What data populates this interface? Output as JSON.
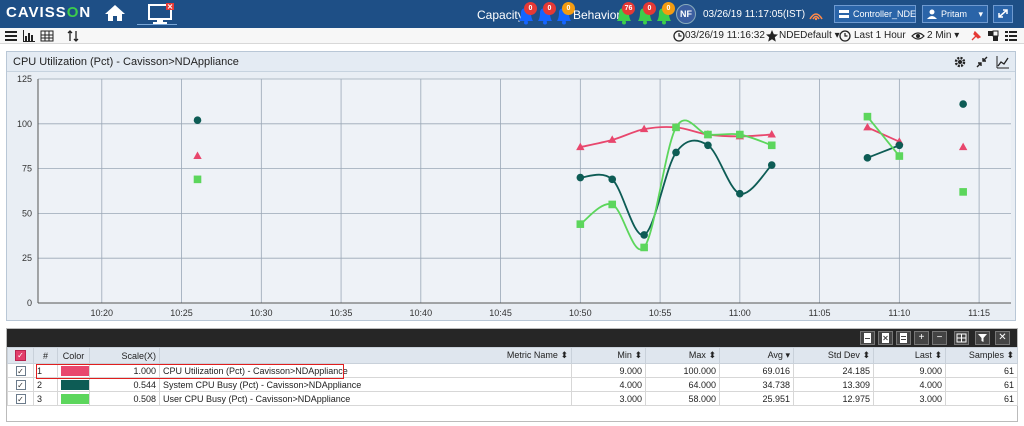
{
  "header": {
    "logo_prefix": "CAVISS",
    "logo_o": "O",
    "logo_suffix": "N",
    "capacity_label": "Capacity",
    "behavior_label": "Behavior",
    "capacity_alerts": [
      "0",
      "0",
      "0"
    ],
    "behavior_alerts": [
      "76",
      "0",
      "0"
    ],
    "avatar": "NF",
    "datetime": "03/26/19 11:17:05(IST)",
    "controller_button": "Controller_NDE",
    "user_button": "Pritam",
    "colors": {
      "bar": "#1e4f86",
      "critical": "#e53935",
      "major": "#f39c12",
      "minor": "#3ccd4b",
      "bell": "#1565ff"
    }
  },
  "toolbar": {
    "timestamp": "03/26/19 11:16:32",
    "favorite": "NDEDefault",
    "duration": "Last 1 Hour",
    "interval": "2 Min"
  },
  "panel": {
    "title": "CPU Utilization (Pct) - Cavisson>NDAppliance"
  },
  "chart_data": {
    "type": "line",
    "title": "CPU Utilization (Pct) - Cavisson>NDAppliance",
    "xlim": [
      "10:16",
      "11:17"
    ],
    "ylim": [
      0,
      125
    ],
    "y_ticks": [
      0,
      25,
      50,
      75,
      100,
      125
    ],
    "x_ticks": [
      "10:20",
      "10:25",
      "10:30",
      "10:35",
      "10:40",
      "10:45",
      "10:50",
      "10:55",
      "11:00",
      "11:05",
      "11:10",
      "11:15"
    ],
    "grid": true,
    "series": [
      {
        "name": "CPU Utilization (Pct) - Cavisson>NDAppliance",
        "color": "#e8476d",
        "marker": "triangle",
        "points": [
          [
            "10:26",
            82
          ],
          [
            "10:50",
            87
          ],
          [
            "10:52",
            91
          ],
          [
            "10:54",
            97
          ],
          [
            "10:56",
            98
          ],
          [
            "10:58",
            94
          ],
          [
            "11:00",
            93
          ],
          [
            "11:02",
            94
          ],
          [
            "11:08",
            98
          ],
          [
            "11:10",
            90
          ],
          [
            "11:14",
            87
          ]
        ],
        "segments": [
          [
            1,
            7
          ],
          [
            8,
            9
          ]
        ]
      },
      {
        "name": "System CPU Busy (Pct) - Cavisson>NDAppliance",
        "color": "#0d5c55",
        "marker": "circle",
        "points": [
          [
            "10:26",
            102
          ],
          [
            "10:50",
            70
          ],
          [
            "10:52",
            69
          ],
          [
            "10:54",
            38
          ],
          [
            "10:56",
            84
          ],
          [
            "10:58",
            88
          ],
          [
            "11:00",
            61
          ],
          [
            "11:02",
            77
          ],
          [
            "11:08",
            81
          ],
          [
            "11:10",
            88
          ],
          [
            "11:14",
            111
          ]
        ],
        "segments": [
          [
            1,
            7
          ],
          [
            8,
            9
          ]
        ]
      },
      {
        "name": "User CPU Busy (Pct) - Cavisson>NDAppliance",
        "color": "#5cd65c",
        "marker": "square",
        "points": [
          [
            "10:26",
            69
          ],
          [
            "10:50",
            44
          ],
          [
            "10:52",
            55
          ],
          [
            "10:54",
            31
          ],
          [
            "10:56",
            98
          ],
          [
            "10:58",
            94
          ],
          [
            "11:00",
            94
          ],
          [
            "11:02",
            88
          ],
          [
            "11:08",
            104
          ],
          [
            "11:10",
            82
          ],
          [
            "11:14",
            62
          ]
        ],
        "segments": [
          [
            1,
            7
          ],
          [
            8,
            9
          ]
        ]
      }
    ]
  },
  "table": {
    "columns": [
      "#",
      "Color",
      "Scale(X)",
      "Metric Name",
      "Min",
      "Max",
      "Avg",
      "Std Dev",
      "Last",
      "Samples"
    ],
    "sort_indicators": {
      "metric": "⬍",
      "min": "⬍",
      "max": "⬍",
      "avg": "▾",
      "std": "⬍",
      "last": "⬍",
      "samples": "⬍"
    },
    "rows": [
      {
        "n": "1",
        "color": "#e8476d",
        "scale": "1.000",
        "metric": "CPU Utilization (Pct) - Cavisson>NDAppliance",
        "min": "9.000",
        "max": "100.000",
        "avg": "69.016",
        "std": "24.185",
        "last": "9.000",
        "samples": "61"
      },
      {
        "n": "2",
        "color": "#0d5c55",
        "scale": "0.544",
        "metric": "System CPU Busy (Pct) - Cavisson>NDAppliance",
        "min": "4.000",
        "max": "64.000",
        "avg": "34.738",
        "std": "13.309",
        "last": "4.000",
        "samples": "61"
      },
      {
        "n": "3",
        "color": "#5cd65c",
        "scale": "0.508",
        "metric": "User CPU Busy (Pct) - Cavisson>NDAppliance",
        "min": "3.000",
        "max": "58.000",
        "avg": "25.951",
        "std": "12.975",
        "last": "3.000",
        "samples": "61"
      }
    ]
  }
}
